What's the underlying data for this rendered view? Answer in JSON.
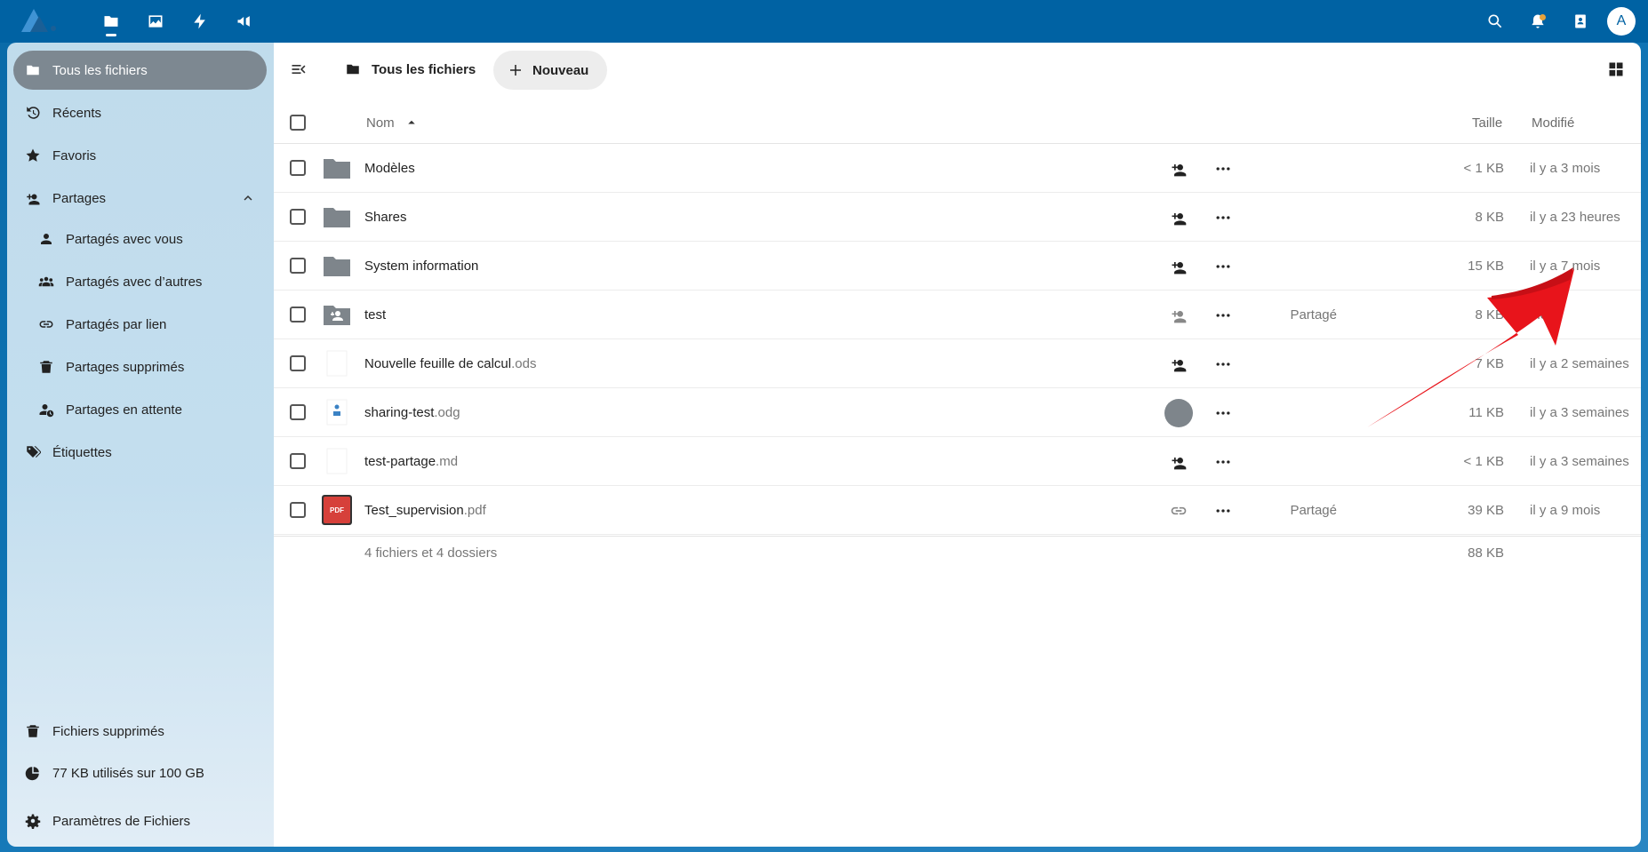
{
  "sidebar": {
    "all_files": "Tous les fichiers",
    "recent": "Récents",
    "favorites": "Favoris",
    "shares": "Partages",
    "shared_with_you": "Partagés avec vous",
    "shared_with_others": "Partagés avec d’autres",
    "shared_by_link": "Partagés par lien",
    "deleted_shares": "Partages supprimés",
    "pending_shares": "Partages en attente",
    "tags": "Étiquettes",
    "deleted_files": "Fichiers supprimés",
    "quota": "77 KB utilisés sur 100 GB",
    "settings": "Paramètres de Fichiers"
  },
  "header": {
    "breadcrumb": "Tous les fichiers",
    "new_button": "Nouveau",
    "avatar_initial": "A"
  },
  "table": {
    "col_name": "Nom",
    "col_size": "Taille",
    "col_modified": "Modifié",
    "rows": [
      {
        "name": "Modèles",
        "ext": "",
        "type": "folder",
        "shared_label": "",
        "size": "< 1 KB",
        "modified": "il y a 3 mois"
      },
      {
        "name": "Shares",
        "ext": "",
        "type": "folder",
        "shared_label": "",
        "size": "8 KB",
        "modified": "il y a 23 heures"
      },
      {
        "name": "System information",
        "ext": "",
        "type": "folder",
        "shared_label": "",
        "size": "15 KB",
        "modified": "il y a 7 mois"
      },
      {
        "name": "test",
        "ext": "",
        "type": "shared-folder",
        "shared_label": "Partagé",
        "size": "8 KB",
        "modified": "hier"
      },
      {
        "name": "Nouvelle feuille de calcul",
        "ext": ".ods",
        "type": "blank",
        "shared_label": "",
        "size": "7 KB",
        "modified": "il y a 2 semaines"
      },
      {
        "name": "sharing-test",
        "ext": ".odg",
        "type": "odg",
        "shared_label": "",
        "size": "11 KB",
        "modified": "il y a 3 semaines"
      },
      {
        "name": "test-partage",
        "ext": ".md",
        "type": "blank",
        "shared_label": "",
        "size": "< 1 KB",
        "modified": "il y a 3 semaines"
      },
      {
        "name": "Test_supervision",
        "ext": ".pdf",
        "type": "pdf",
        "shared_label": "Partagé",
        "size": "39 KB",
        "modified": "il y a 9 mois"
      }
    ],
    "pdf_badge": "PDF",
    "summary": "4 fichiers et 4 dossiers",
    "summary_size": "88 KB"
  },
  "colors": {
    "topbar": "#0062a3",
    "active_nav": "#7d8891",
    "folder": "#7e858b",
    "pdf": "#d6403a",
    "annotation_arrow": "#e8141b"
  }
}
